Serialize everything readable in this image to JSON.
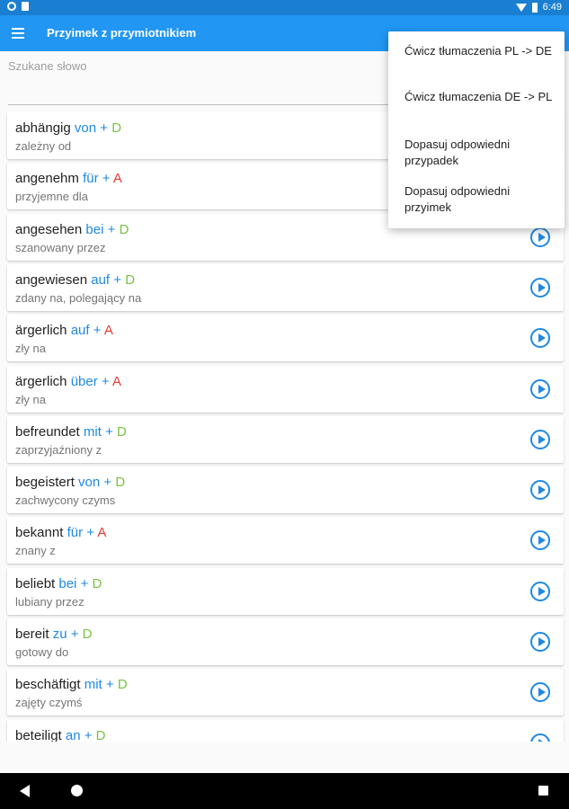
{
  "status_bar": {
    "time": "6:49"
  },
  "app_bar": {
    "title": "Przyimek z przymiotnikiem"
  },
  "search": {
    "label": "Szukane słowo",
    "value": ""
  },
  "popup_menu": {
    "items": [
      "Ćwicz tłumaczenia PL -> DE",
      "Ćwicz tłumaczenia DE -> PL",
      "Dopasuj odpowiedni przypadek",
      "Dopasuj odpowiedni przyimek"
    ]
  },
  "entries": [
    {
      "word": "abhängig",
      "prep": "von",
      "plus": "+",
      "case": "D",
      "translation": "zależny od"
    },
    {
      "word": "angenehm",
      "prep": "für",
      "plus": "+",
      "case": "A",
      "translation": "przyjemne dla"
    },
    {
      "word": "angesehen",
      "prep": "bei",
      "plus": "+",
      "case": "D",
      "translation": "szanowany przez"
    },
    {
      "word": "angewiesen",
      "prep": "auf",
      "plus": "+",
      "case": "D",
      "translation": "zdany na, polegający na"
    },
    {
      "word": "ärgerlich",
      "prep": "auf",
      "plus": "+",
      "case": "A",
      "translation": "zły na"
    },
    {
      "word": "ärgerlich",
      "prep": "über",
      "plus": "+",
      "case": "A",
      "translation": "zły na"
    },
    {
      "word": "befreundet",
      "prep": "mit",
      "plus": "+",
      "case": "D",
      "translation": "zaprzyjaźniony z"
    },
    {
      "word": "begeistert",
      "prep": "von",
      "plus": "+",
      "case": "D",
      "translation": "zachwycony czyms"
    },
    {
      "word": "bekannt",
      "prep": "für",
      "plus": "+",
      "case": "A",
      "translation": "znany z"
    },
    {
      "word": "beliebt",
      "prep": "bei",
      "plus": "+",
      "case": "D",
      "translation": "lubiany przez"
    },
    {
      "word": "bereit",
      "prep": "zu",
      "plus": "+",
      "case": "D",
      "translation": "gotowy do"
    },
    {
      "word": "beschäftigt",
      "prep": "mit",
      "plus": "+",
      "case": "D",
      "translation": "zajęty czymś"
    },
    {
      "word": "beteiligt",
      "prep": "an",
      "plus": "+",
      "case": "D",
      "translation": ""
    }
  ],
  "colors": {
    "status_bar": "#1a7fd1",
    "app_bar": "#2196f3",
    "preposition": "#1e88e5",
    "case_dative": "#76c442",
    "case_accusative": "#e53935"
  },
  "icons": [
    "menu-icon",
    "play-icon",
    "back-icon",
    "home-icon",
    "recents-icon",
    "wifi-icon",
    "battery-icon"
  ]
}
